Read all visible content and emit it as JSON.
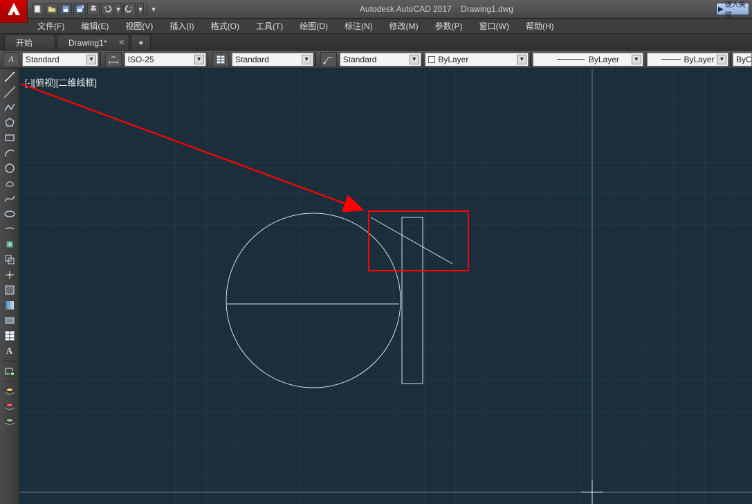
{
  "title": {
    "app": "Autodesk AutoCAD 2017",
    "doc": "Drawing1.dwg"
  },
  "searchPlaceholder": "键入关键",
  "menus": [
    "文件(F)",
    "编辑(E)",
    "视图(V)",
    "插入(I)",
    "格式(O)",
    "工具(T)",
    "绘图(D)",
    "标注(N)",
    "修改(M)",
    "参数(P)",
    "窗口(W)",
    "帮助(H)"
  ],
  "tabs": {
    "start": "开始",
    "doc": "Drawing1*",
    "add": "+"
  },
  "styles": {
    "textStyle": "Standard",
    "dimStyle": "ISO-25",
    "tableStyle": "Standard",
    "mlStyle": "Standard",
    "layerColor": "ByLayer",
    "lineType": "ByLayer",
    "lineWeight": "ByLayer",
    "plot": "ByC"
  },
  "viewport": {
    "label": "[-][俯视][二维线框]"
  },
  "qat": {
    "new": "new-icon",
    "open": "open-icon",
    "save": "save-icon",
    "saveas": "saveas-icon",
    "print": "print-icon",
    "undo": "undo-icon",
    "redo": "redo-icon"
  }
}
